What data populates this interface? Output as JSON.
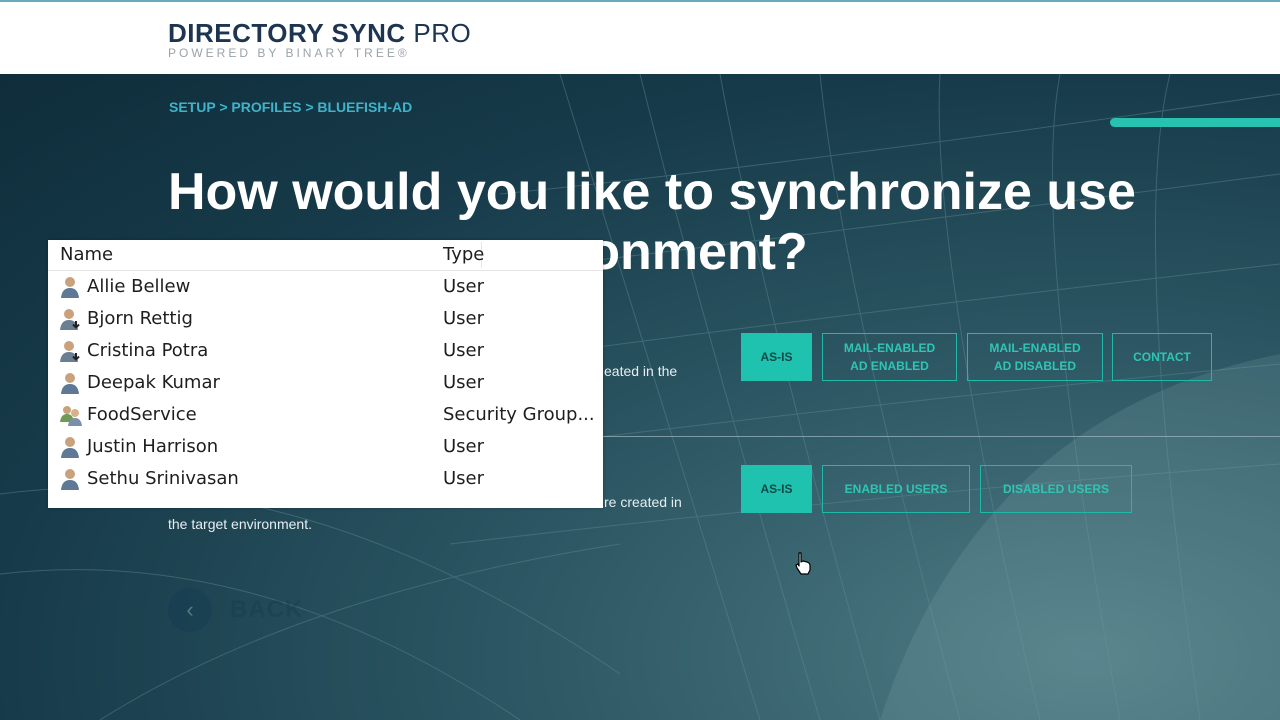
{
  "brand": {
    "title_bold": "DIRECTORY SYNC",
    "title_light": "PRO",
    "subtitle": "POWERED BY BINARY TREE®"
  },
  "breadcrumb": {
    "items": [
      "SETUP",
      "PROFILES",
      "BLUEFISH-AD"
    ],
    "separator": ">"
  },
  "progress": {
    "fraction": 0.85
  },
  "headline": {
    "line1": "How would you like to synchronize use",
    "line2": "ronment?"
  },
  "section1": {
    "desc_fragment": "eated in the",
    "options": [
      {
        "label": "AS-IS",
        "selected": true
      },
      {
        "label": "MAIL-ENABLED\nAD ENABLED",
        "selected": false
      },
      {
        "label": "MAIL-ENABLED\nAD DISABLED",
        "selected": false
      },
      {
        "label": "CONTACT",
        "selected": false
      }
    ]
  },
  "section2": {
    "desc_fragment": "re created in",
    "desc_line2": "the target environment.",
    "options": [
      {
        "label": "AS-IS",
        "selected": true
      },
      {
        "label": "ENABLED USERS",
        "selected": false
      },
      {
        "label": "DISABLED USERS",
        "selected": false
      }
    ]
  },
  "back_button": {
    "label": "BACK",
    "icon": "chevron-left-icon"
  },
  "object_list": {
    "columns": [
      "Name",
      "Type"
    ],
    "rows": [
      {
        "name": "Allie Bellew",
        "type": "User",
        "icon": "user-icon"
      },
      {
        "name": "Bjorn Rettig",
        "type": "User",
        "icon": "user-download-icon"
      },
      {
        "name": "Cristina Potra",
        "type": "User",
        "icon": "user-download-icon"
      },
      {
        "name": "Deepak Kumar",
        "type": "User",
        "icon": "user-icon"
      },
      {
        "name": "FoodService",
        "type": "Security Group...",
        "icon": "group-icon"
      },
      {
        "name": "Justin Harrison",
        "type": "User",
        "icon": "user-icon"
      },
      {
        "name": "Sethu Srinivasan",
        "type": "User",
        "icon": "user-icon"
      }
    ]
  },
  "colors": {
    "accent": "#1fc2ae",
    "breadcrumb": "#3fb4c9",
    "brand_text": "#1d3550"
  }
}
